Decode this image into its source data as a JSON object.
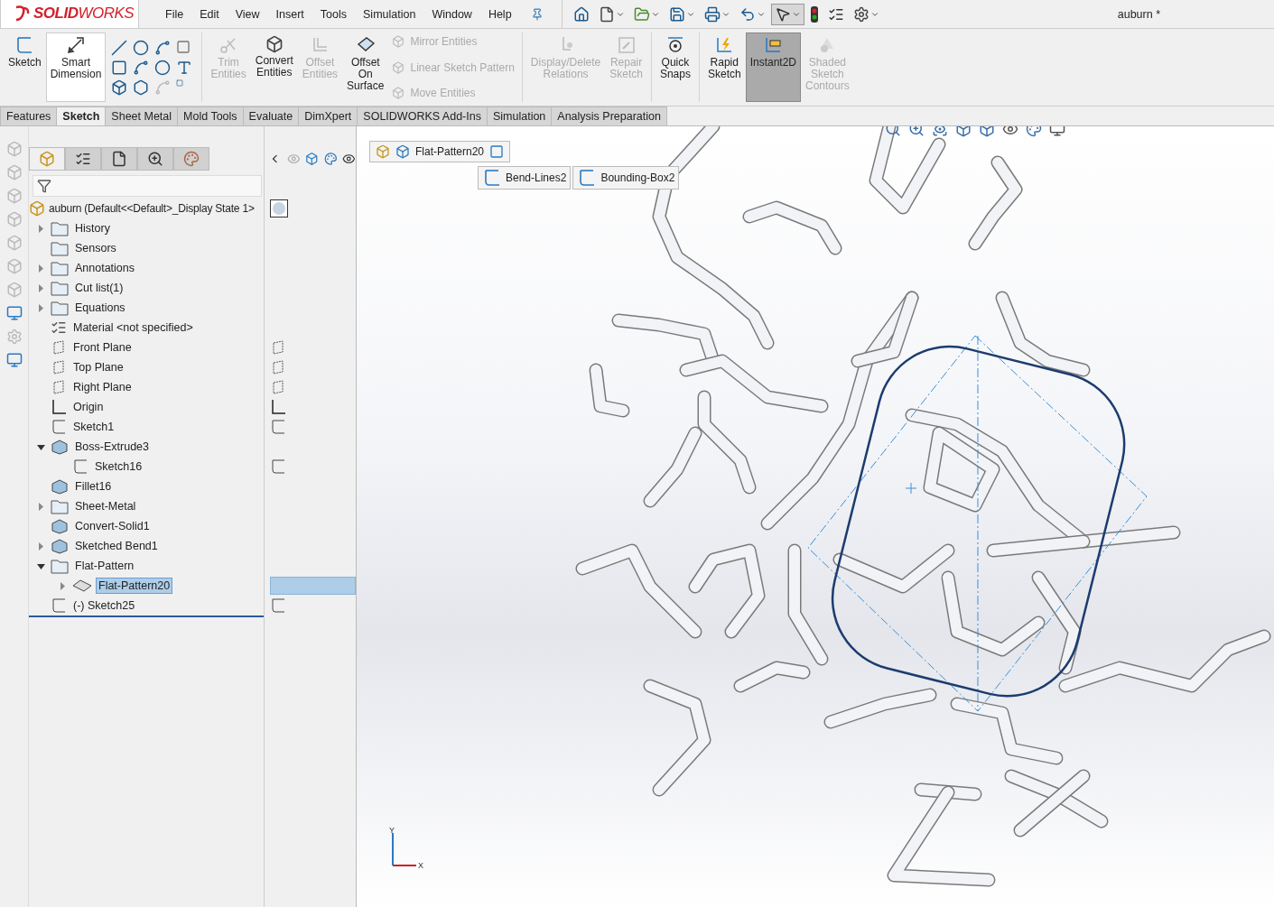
{
  "app": {
    "logo": "**SOLID**WORKS",
    "document_title": "auburn *"
  },
  "menu": [
    "File",
    "Edit",
    "View",
    "Insert",
    "Tools",
    "Simulation",
    "Window",
    "Help"
  ],
  "ribbon": {
    "large_commands": [
      {
        "label": "Sketch",
        "kind": "sketch",
        "disabled": false,
        "selected": false
      },
      {
        "label": "Smart Dimension",
        "kind": "dimension",
        "disabled": false,
        "selected": false
      },
      {
        "label": "Trim Entities",
        "kind": "trim",
        "disabled": true,
        "selected": false
      },
      {
        "label": "Convert Entities",
        "kind": "convert",
        "disabled": false,
        "selected": false
      },
      {
        "label": "Offset Entities",
        "kind": "offset",
        "disabled": true,
        "selected": false
      },
      {
        "label": "Offset On Surface",
        "kind": "surface",
        "disabled": false,
        "selected": false
      }
    ],
    "small_commands": [
      {
        "label": "Mirror Entities",
        "disabled": true
      },
      {
        "label": "Linear Sketch Pattern",
        "disabled": true
      },
      {
        "label": "Move Entities",
        "disabled": true
      }
    ],
    "right_commands": [
      {
        "label": "Display/Delete Relations",
        "kind": "relations",
        "disabled": true,
        "selected": false
      },
      {
        "label": "Repair Sketch",
        "kind": "repair",
        "disabled": true,
        "selected": false
      },
      {
        "label": "Quick Snaps",
        "kind": "snaps",
        "disabled": false,
        "selected": false
      },
      {
        "label": "Rapid Sketch",
        "kind": "rapid",
        "disabled": false,
        "selected": false
      },
      {
        "label": "Instant2D",
        "kind": "instant",
        "disabled": false,
        "selected": true
      },
      {
        "label": "Shaded Sketch Contours",
        "kind": "shaded",
        "disabled": true,
        "selected": false
      }
    ]
  },
  "tabs": [
    {
      "label": "Features",
      "selected": false
    },
    {
      "label": "Sketch",
      "selected": true
    },
    {
      "label": "Sheet Metal",
      "selected": false
    },
    {
      "label": "Mold Tools",
      "selected": false
    },
    {
      "label": "Evaluate",
      "selected": false
    },
    {
      "label": "DimXpert",
      "selected": false
    },
    {
      "label": "SOLIDWORKS Add-Ins",
      "selected": false
    },
    {
      "label": "Simulation",
      "selected": false
    },
    {
      "label": "Analysis Preparation",
      "selected": false
    }
  ],
  "feature_tree": {
    "root": "auburn  (Default<<Default>_Display State 1>",
    "items": [
      {
        "label": "History",
        "kind": "folder",
        "expanded": false,
        "selected": false
      },
      {
        "label": "Sensors",
        "kind": "folder",
        "selected": false
      },
      {
        "label": "Annotations",
        "kind": "folder",
        "expanded": false,
        "selected": false
      },
      {
        "label": "Cut list(1)",
        "kind": "folder",
        "expanded": false,
        "selected": false
      },
      {
        "label": "Equations",
        "kind": "folder",
        "expanded": false,
        "selected": false
      },
      {
        "label": "Material <not specified>",
        "kind": "material",
        "selected": false
      },
      {
        "label": "Front Plane",
        "kind": "plane",
        "selected": false
      },
      {
        "label": "Top Plane",
        "kind": "plane",
        "selected": false
      },
      {
        "label": "Right Plane",
        "kind": "plane",
        "selected": false
      },
      {
        "label": "Origin",
        "kind": "origin",
        "selected": false
      },
      {
        "label": "Sketch1",
        "kind": "sketch",
        "selected": false
      },
      {
        "label": "Boss-Extrude3",
        "kind": "feature",
        "expanded": true,
        "selected": false,
        "children": [
          {
            "label": "Sketch16",
            "kind": "sketch",
            "selected": false
          }
        ]
      },
      {
        "label": "Fillet16",
        "kind": "feature",
        "selected": false
      },
      {
        "label": "Sheet-Metal",
        "kind": "folder",
        "expanded": false,
        "selected": false
      },
      {
        "label": "Convert-Solid1",
        "kind": "feature",
        "selected": false
      },
      {
        "label": "Sketched Bend1",
        "kind": "feature",
        "expanded": false,
        "selected": false
      },
      {
        "label": "Flat-Pattern",
        "kind": "folder",
        "expanded": true,
        "selected": false,
        "children": [
          {
            "label": "Flat-Pattern20",
            "kind": "flat",
            "expanded": false,
            "selected": true
          }
        ]
      },
      {
        "label": "(-) Sketch25",
        "kind": "sketch",
        "selected": false
      }
    ]
  },
  "breadcrumb": {
    "path": [
      "Flat-Pattern20"
    ],
    "children": [
      "Bend-Lines2",
      "Bounding-Box2"
    ]
  },
  "triad": {
    "y": "Y",
    "x": "X"
  }
}
